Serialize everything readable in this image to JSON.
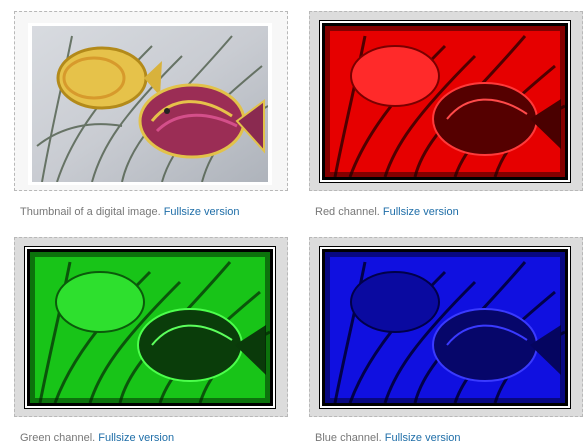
{
  "gallery": {
    "items": [
      {
        "caption": "Thumbnail of a digital image.",
        "link": "Fullsize version",
        "channel": "original",
        "tint": "#ffffff"
      },
      {
        "caption": "Red channel.",
        "link": "Fullsize version",
        "channel": "red",
        "tint": "#ff0000"
      },
      {
        "caption": "Green channel.",
        "link": "Fullsize version",
        "channel": "green",
        "tint": "#00ff00"
      },
      {
        "caption": "Blue channel.",
        "link": "Fullsize version",
        "channel": "blue",
        "tint": "#0000ff"
      }
    ],
    "link_color": "#1f6ea8",
    "caption_color": "#777777"
  }
}
